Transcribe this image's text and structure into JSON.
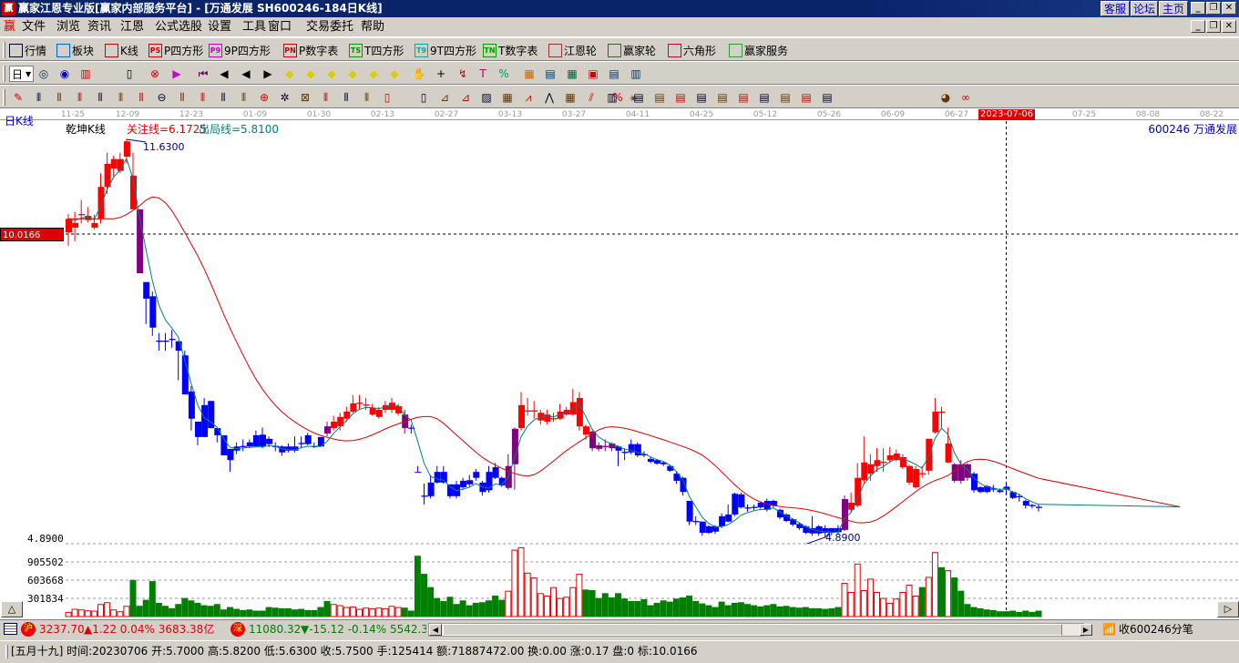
{
  "window": {
    "title": "赢家江恩专业版[赢家内部服务平台] - [万通发展   SH600246-184日K线]",
    "links": [
      "客服",
      "论坛",
      "主页"
    ]
  },
  "menu": [
    "文件",
    "浏览",
    "资讯",
    "江恩",
    "公式选股",
    "设置",
    "工具",
    "窗口",
    "交易委托",
    "帮助"
  ],
  "toolbar1": [
    {
      "icon": "quote-table-icon",
      "label": "行情"
    },
    {
      "icon": "sector-blocks-icon",
      "label": "板块"
    },
    {
      "icon": "kline-icon",
      "label": "K线"
    },
    {
      "icon": "ps-icon",
      "badge": "PS",
      "label": "P四方形"
    },
    {
      "icon": "p9-icon",
      "badge": "P9",
      "label": "9P四方形"
    },
    {
      "icon": "pn-icon",
      "badge": "PN",
      "label": "P数字表"
    },
    {
      "icon": "ts-icon",
      "badge": "TS",
      "label": "T四方形"
    },
    {
      "icon": "t9-icon",
      "badge": "T9",
      "label": "9T四方形"
    },
    {
      "icon": "tn-icon",
      "badge": "TN",
      "label": "T数字表"
    },
    {
      "icon": "gann-wheel-icon",
      "label": "江恩轮"
    },
    {
      "icon": "winner-wheel-icon",
      "label": "赢家轮"
    },
    {
      "icon": "hexagon-icon",
      "label": "六角形"
    },
    {
      "icon": "dollar-icon",
      "label": "赢家服务"
    }
  ],
  "toolbar2": {
    "period": "日",
    "icons": [
      "view-icon",
      "spiral-icon",
      "kline-bars-icon",
      "volume-dropdown-icon",
      "indicator-icon",
      "flag-icon",
      "first-icon",
      "prev-icon",
      "back-icon",
      "next-icon",
      "yellow-diamond-1-icon",
      "yellow-diamond-2-icon",
      "yellow-diamond-3-icon",
      "yellow-diamond-4-icon",
      "yellow-diamond-5-icon",
      "yellow-diamond-6-icon",
      "hand-icon",
      "crosshair-icon",
      "line-draw-icon",
      "text-tool-icon",
      "formula-icon",
      "calendar-icon",
      "calculator-icon",
      "table-icon",
      "save-icon",
      "print-icon",
      "export-icon"
    ]
  },
  "toolbar3": {
    "icons": [
      "pencil-icon",
      "vline-icon",
      "fib-icon",
      "fib2-icon",
      "fib3-icon",
      "fib4-icon",
      "fib5-icon",
      "circle-icon",
      "bars-icon",
      "bars2-icon",
      "bars3-icon",
      "bars4-icon",
      "compass-icon",
      "star-icon",
      "square-icon",
      "cycle-icon",
      "cycle2-icon",
      "cycle3-icon",
      "rect-tool-icon",
      "rect-tool2-icon",
      "fan-icon",
      "fan2-icon",
      "gann-box-icon",
      "gann-grid-icon",
      "angle-icon",
      "wave-icon",
      "grid-icon",
      "parallel-icon",
      "ruler-icon",
      "percent-fan-icon",
      "percent-icon",
      "level-icon",
      "level2-icon",
      "level3-icon",
      "level4-icon",
      "level5-icon",
      "level6-icon",
      "level7-icon",
      "level8-icon",
      "level9-icon",
      "level10-icon",
      "pie-icon",
      "infinity-icon"
    ]
  },
  "chart": {
    "period_label": "日K线",
    "indicator_name": "乾坤K线",
    "focus_line": "关注线=6.1725",
    "exit_line": "出局线=5.8100",
    "high_label": "11.6300",
    "low_label": "4.8900",
    "stock": "600246  万通发展",
    "cursor_price": "10.0166",
    "selected_date": "2023-07-06",
    "price_axis": "4.8900",
    "volume_ticks": [
      "905502",
      "603668",
      "301834"
    ]
  },
  "chart_data": {
    "type": "candlestick",
    "x_tick_labels": [
      "11-25",
      "12-09",
      "12-23",
      "01-09",
      "01-30",
      "02-13",
      "02-27",
      "03-13",
      "03-27",
      "04-11",
      "04-25",
      "05-12",
      "05-26",
      "06-09",
      "06-27",
      "2023-07-06",
      "07-25",
      "08-08",
      "08-22"
    ],
    "ylim": [
      4.89,
      11.63
    ],
    "volume_ticks": [
      301834,
      603668,
      905502
    ],
    "colors": {
      "r": "#ff0000",
      "b": "#0000ff",
      "p": "#800080",
      "ma_fast": "#008080",
      "ma_slow": "#e00000"
    },
    "candles": [
      [
        10.05,
        10.28,
        10.36,
        9.82,
        "r"
      ],
      [
        10.13,
        10.21,
        10.4,
        9.9,
        "r"
      ],
      [
        10.34,
        10.36,
        10.6,
        10.2,
        "r"
      ],
      [
        10.26,
        10.33,
        10.48,
        10.22,
        "r"
      ],
      [
        10.13,
        10.21,
        10.35,
        10.1,
        "r"
      ],
      [
        10.28,
        10.82,
        11.05,
        10.2,
        "r"
      ],
      [
        10.82,
        11.21,
        11.4,
        10.7,
        "r"
      ],
      [
        11.13,
        11.29,
        11.35,
        10.98,
        "r"
      ],
      [
        11.09,
        11.29,
        11.4,
        11.05,
        "r"
      ],
      [
        11.33,
        11.59,
        11.63,
        11.22,
        "r"
      ],
      [
        11.01,
        10.44,
        11.4,
        10.44,
        "r"
      ],
      [
        10.44,
        9.36,
        10.44,
        9.36,
        "p"
      ],
      [
        9.21,
        8.93,
        9.21,
        8.5,
        "b"
      ],
      [
        8.97,
        8.44,
        9.05,
        8.3,
        "b"
      ],
      [
        8.22,
        8.2,
        8.35,
        8.05,
        "b"
      ],
      [
        8.22,
        8.2,
        8.35,
        8.05,
        "b"
      ],
      [
        8.25,
        8.23,
        8.4,
        8.1,
        "b"
      ],
      [
        8.21,
        8.05,
        8.21,
        7.55,
        "b"
      ],
      [
        7.97,
        7.31,
        8.05,
        7.31,
        "b"
      ],
      [
        7.36,
        6.9,
        7.45,
        6.7,
        "b"
      ],
      [
        6.85,
        6.59,
        6.85,
        6.45,
        "b"
      ],
      [
        7.13,
        6.59,
        7.25,
        6.59,
        "b"
      ],
      [
        7.2,
        6.74,
        7.2,
        6.74,
        "b"
      ],
      [
        6.74,
        6.62,
        6.74,
        6.5,
        "b"
      ],
      [
        6.62,
        6.28,
        6.62,
        6.28,
        "b"
      ],
      [
        6.39,
        6.2,
        6.39,
        6.0,
        "b"
      ],
      [
        6.43,
        6.36,
        6.5,
        6.3,
        "b"
      ],
      [
        6.44,
        6.42,
        6.55,
        6.35,
        "b"
      ],
      [
        6.5,
        6.43,
        6.55,
        6.4,
        "b"
      ],
      [
        6.62,
        6.43,
        6.7,
        6.43,
        "b"
      ],
      [
        6.63,
        6.43,
        6.75,
        6.4,
        "b"
      ],
      [
        6.56,
        6.47,
        6.6,
        6.42,
        "b"
      ],
      [
        6.44,
        6.42,
        6.5,
        6.35,
        "b"
      ],
      [
        6.43,
        6.33,
        6.45,
        6.27,
        "b"
      ],
      [
        6.43,
        6.36,
        6.48,
        6.33,
        "b"
      ],
      [
        6.43,
        6.36,
        6.6,
        6.33,
        "b"
      ],
      [
        6.49,
        6.47,
        6.6,
        6.4,
        "b"
      ],
      [
        6.62,
        6.47,
        6.66,
        6.45,
        "b"
      ],
      [
        6.44,
        6.42,
        6.5,
        6.4,
        "b"
      ],
      [
        6.59,
        6.43,
        6.59,
        6.43,
        "b"
      ],
      [
        6.77,
        6.65,
        6.85,
        6.6,
        "p"
      ],
      [
        6.74,
        6.85,
        6.95,
        6.7,
        "r"
      ],
      [
        6.77,
        6.93,
        7.0,
        6.7,
        "r"
      ],
      [
        6.9,
        7.02,
        7.1,
        6.85,
        "r"
      ],
      [
        7.02,
        7.16,
        7.3,
        7.0,
        "r"
      ],
      [
        7.15,
        7.17,
        7.3,
        7.05,
        "r"
      ],
      [
        7.12,
        7.14,
        7.25,
        7.05,
        "r"
      ],
      [
        6.97,
        7.08,
        7.15,
        6.95,
        "r"
      ],
      [
        6.93,
        7.05,
        7.1,
        6.9,
        "r"
      ],
      [
        7.05,
        7.13,
        7.2,
        7.0,
        "r"
      ],
      [
        7.05,
        7.17,
        7.25,
        7.0,
        "r"
      ],
      [
        6.99,
        7.11,
        7.15,
        6.95,
        "r"
      ],
      [
        6.97,
        6.74,
        7.05,
        6.65,
        "p"
      ],
      [
        6.75,
        6.73,
        6.8,
        6.65,
        "b"
      ],
      [
        6.0,
        6.0,
        6.1,
        6.0,
        "b"
      ],
      [
        5.6,
        5.58,
        5.8,
        5.45,
        "b"
      ],
      [
        5.82,
        5.59,
        5.95,
        5.55,
        "b"
      ],
      [
        6.0,
        5.82,
        6.1,
        5.8,
        "b"
      ],
      [
        6.0,
        5.82,
        6.1,
        5.8,
        "b"
      ],
      [
        5.79,
        5.59,
        5.79,
        5.55,
        "b"
      ],
      [
        5.79,
        5.59,
        5.85,
        5.55,
        "b"
      ],
      [
        5.85,
        5.74,
        5.9,
        5.7,
        "b"
      ],
      [
        5.86,
        5.79,
        5.95,
        5.75,
        "b"
      ],
      [
        6.0,
        5.9,
        6.05,
        5.85,
        "b"
      ],
      [
        5.82,
        5.66,
        5.85,
        5.6,
        "b"
      ],
      [
        6.0,
        5.69,
        6.1,
        5.65,
        "b"
      ],
      [
        6.08,
        5.9,
        6.15,
        5.88,
        "b"
      ],
      [
        5.9,
        5.77,
        5.92,
        5.75,
        "b"
      ],
      [
        5.73,
        6.1,
        6.3,
        5.7,
        "p"
      ],
      [
        6.13,
        6.73,
        6.75,
        5.7,
        "p"
      ],
      [
        6.74,
        7.13,
        7.35,
        6.7,
        "r"
      ],
      [
        7.02,
        7.04,
        7.25,
        6.95,
        "r"
      ],
      [
        7.02,
        7.04,
        7.2,
        6.9,
        "r"
      ],
      [
        6.87,
        7.0,
        7.05,
        6.8,
        "r"
      ],
      [
        6.85,
        6.97,
        7.05,
        6.8,
        "r"
      ],
      [
        6.89,
        6.91,
        7.0,
        6.85,
        "r"
      ],
      [
        6.9,
        7.02,
        7.15,
        6.88,
        "r"
      ],
      [
        6.97,
        7.05,
        7.1,
        6.95,
        "r"
      ],
      [
        6.97,
        7.18,
        7.4,
        6.95,
        "r"
      ],
      [
        6.77,
        7.25,
        7.35,
        6.7,
        "r"
      ],
      [
        6.77,
        6.63,
        6.8,
        6.55,
        "r"
      ],
      [
        6.68,
        6.4,
        6.7,
        6.35,
        "p"
      ],
      [
        6.45,
        6.39,
        6.5,
        6.35,
        "p"
      ],
      [
        6.44,
        6.42,
        6.55,
        6.35,
        "p"
      ],
      [
        6.48,
        6.4,
        6.5,
        6.35,
        "p"
      ],
      [
        6.43,
        6.36,
        6.45,
        6.1,
        "b"
      ],
      [
        6.34,
        6.32,
        6.4,
        6.2,
        "b"
      ],
      [
        6.47,
        6.33,
        6.55,
        6.3,
        "b"
      ],
      [
        6.47,
        6.28,
        6.5,
        6.25,
        "b"
      ],
      [
        6.3,
        6.28,
        6.35,
        6.25,
        "b"
      ],
      [
        6.22,
        6.17,
        6.25,
        6.15,
        "b"
      ],
      [
        6.2,
        6.14,
        6.22,
        6.12,
        "b"
      ],
      [
        6.16,
        6.13,
        6.18,
        6.1,
        "b"
      ],
      [
        6.1,
        6.02,
        6.12,
        6.0,
        "b"
      ],
      [
        5.97,
        5.85,
        6.0,
        5.8,
        "b"
      ],
      [
        5.9,
        5.66,
        5.92,
        5.6,
        "b"
      ],
      [
        5.51,
        5.16,
        5.51,
        5.1,
        "b"
      ],
      [
        5.17,
        5.15,
        5.25,
        5.1,
        "b"
      ],
      [
        5.16,
        4.97,
        5.16,
        4.92,
        "b"
      ],
      [
        5.08,
        4.97,
        5.1,
        4.95,
        "b"
      ],
      [
        5.08,
        4.99,
        5.1,
        4.95,
        "b"
      ],
      [
        5.25,
        5.08,
        5.3,
        5.05,
        "b"
      ],
      [
        5.28,
        5.16,
        5.45,
        5.15,
        "b"
      ],
      [
        5.63,
        5.28,
        5.65,
        5.25,
        "b"
      ],
      [
        5.62,
        5.4,
        5.65,
        5.38,
        "b"
      ],
      [
        5.4,
        5.38,
        5.45,
        5.33,
        "b"
      ],
      [
        5.41,
        5.39,
        5.45,
        5.35,
        "b"
      ],
      [
        5.48,
        5.4,
        5.5,
        5.38,
        "b"
      ],
      [
        5.51,
        5.36,
        5.55,
        5.33,
        "b"
      ],
      [
        5.51,
        5.43,
        5.53,
        5.4,
        "b"
      ],
      [
        5.36,
        5.23,
        5.38,
        5.2,
        "b"
      ],
      [
        5.28,
        5.17,
        5.3,
        5.15,
        "b"
      ],
      [
        5.2,
        5.11,
        5.22,
        5.08,
        "b"
      ],
      [
        5.12,
        5.05,
        5.15,
        5.02,
        "b"
      ],
      [
        5.08,
        4.97,
        5.1,
        4.95,
        "b"
      ],
      [
        5.05,
        4.96,
        5.25,
        4.92,
        "b"
      ],
      [
        5.08,
        4.96,
        5.1,
        4.92,
        "b"
      ],
      [
        5.05,
        4.97,
        5.1,
        4.89,
        "b"
      ],
      [
        5.05,
        4.97,
        5.05,
        4.93,
        "b"
      ],
      [
        5.05,
        4.98,
        5.1,
        4.95,
        "b"
      ],
      [
        5.02,
        5.54,
        5.6,
        5.0,
        "p"
      ],
      [
        5.36,
        5.48,
        5.65,
        5.3,
        "r"
      ],
      [
        5.43,
        5.9,
        6.15,
        5.4,
        "r"
      ],
      [
        5.86,
        6.16,
        6.6,
        5.8,
        "r"
      ],
      [
        5.97,
        6.13,
        6.3,
        5.85,
        "r"
      ],
      [
        6.1,
        6.2,
        6.4,
        6.0,
        "r"
      ],
      [
        6.15,
        6.17,
        6.4,
        6.0,
        "r"
      ],
      [
        6.2,
        6.28,
        6.42,
        6.15,
        "r"
      ],
      [
        6.2,
        6.31,
        6.38,
        6.18,
        "r"
      ],
      [
        6.08,
        6.25,
        6.3,
        6.05,
        "r"
      ],
      [
        5.82,
        6.1,
        6.12,
        5.78,
        "r"
      ],
      [
        5.74,
        6.05,
        6.1,
        5.72,
        "r"
      ],
      [
        5.98,
        5.96,
        6.1,
        5.9,
        "r"
      ],
      [
        6.02,
        6.56,
        6.56,
        5.95,
        "r"
      ],
      [
        6.67,
        7.02,
        7.25,
        6.65,
        "r"
      ],
      [
        7.02,
        7.0,
        7.1,
        6.75,
        "r"
      ],
      [
        6.16,
        6.48,
        6.75,
        6.15,
        "r"
      ],
      [
        6.13,
        5.85,
        6.15,
        5.82,
        "p"
      ],
      [
        6.13,
        5.85,
        6.2,
        5.8,
        "p"
      ],
      [
        6.13,
        5.9,
        6.15,
        5.85,
        "p"
      ],
      [
        5.97,
        5.69,
        6.0,
        5.65,
        "b"
      ],
      [
        5.74,
        5.66,
        5.76,
        5.64,
        "b"
      ],
      [
        5.76,
        5.66,
        5.78,
        5.64,
        "b"
      ],
      [
        5.72,
        5.7,
        5.78,
        5.66,
        "b"
      ],
      [
        5.69,
        5.66,
        5.72,
        5.64,
        "b"
      ],
      [
        5.7,
        5.75,
        5.82,
        5.63,
        "b"
      ],
      [
        5.66,
        5.56,
        5.68,
        5.54,
        "b"
      ],
      [
        5.59,
        5.57,
        5.62,
        5.5,
        "b"
      ],
      [
        5.51,
        5.43,
        5.53,
        5.38,
        "b"
      ],
      [
        5.44,
        5.42,
        5.46,
        5.38,
        "b"
      ],
      [
        5.41,
        5.39,
        5.45,
        5.33,
        "b"
      ]
    ],
    "volumes_thousands": [
      70,
      120,
      110,
      95,
      90,
      200,
      230,
      110,
      80,
      170,
      600,
      170,
      270,
      580,
      220,
      170,
      130,
      200,
      300,
      260,
      220,
      180,
      170,
      200,
      110,
      150,
      120,
      100,
      110,
      90,
      90,
      150,
      140,
      130,
      130,
      110,
      120,
      100,
      100,
      150,
      250,
      200,
      180,
      150,
      160,
      120,
      140,
      130,
      140,
      130,
      170,
      150,
      140,
      90,
      1000,
      700,
      480,
      300,
      250,
      320,
      200,
      260,
      180,
      220,
      230,
      260,
      340,
      270,
      420,
      1100,
      1140,
      720,
      640,
      380,
      340,
      480,
      300,
      320,
      480,
      700,
      440,
      430,
      300,
      380,
      310,
      380,
      290,
      250,
      250,
      280,
      180,
      220,
      260,
      240,
      290,
      310,
      340,
      250,
      210,
      180,
      150,
      240,
      180,
      220,
      230,
      200,
      180,
      160,
      180,
      200,
      160,
      170,
      150,
      140,
      150,
      130,
      130,
      120,
      130,
      150,
      550,
      400,
      870,
      430,
      620,
      400,
      300,
      220,
      290,
      400,
      520,
      340,
      480,
      650,
      1060,
      810,
      760,
      640,
      420,
      200,
      150,
      130,
      110,
      100,
      80,
      80,
      90,
      70,
      90,
      70,
      90
    ],
    "selected_index": 145
  },
  "index_bar": {
    "sh_badge": "沪",
    "sh": "3237.70",
    "sh_change": "▲1.22 0.04% 3683.38亿",
    "sz_badge": "深",
    "sz": "11080.32",
    "sz_change": "▼-15.12 -0.14% 5542.3",
    "feed": "收600246分笔"
  },
  "status": "[五月十九] 时间:20230706 开:5.7000 高:5.8200 低:5.6300 收:5.7500 手:125414 额:71887472.00 换:0.00 涨:0.17 盘:0 标:10.0166"
}
